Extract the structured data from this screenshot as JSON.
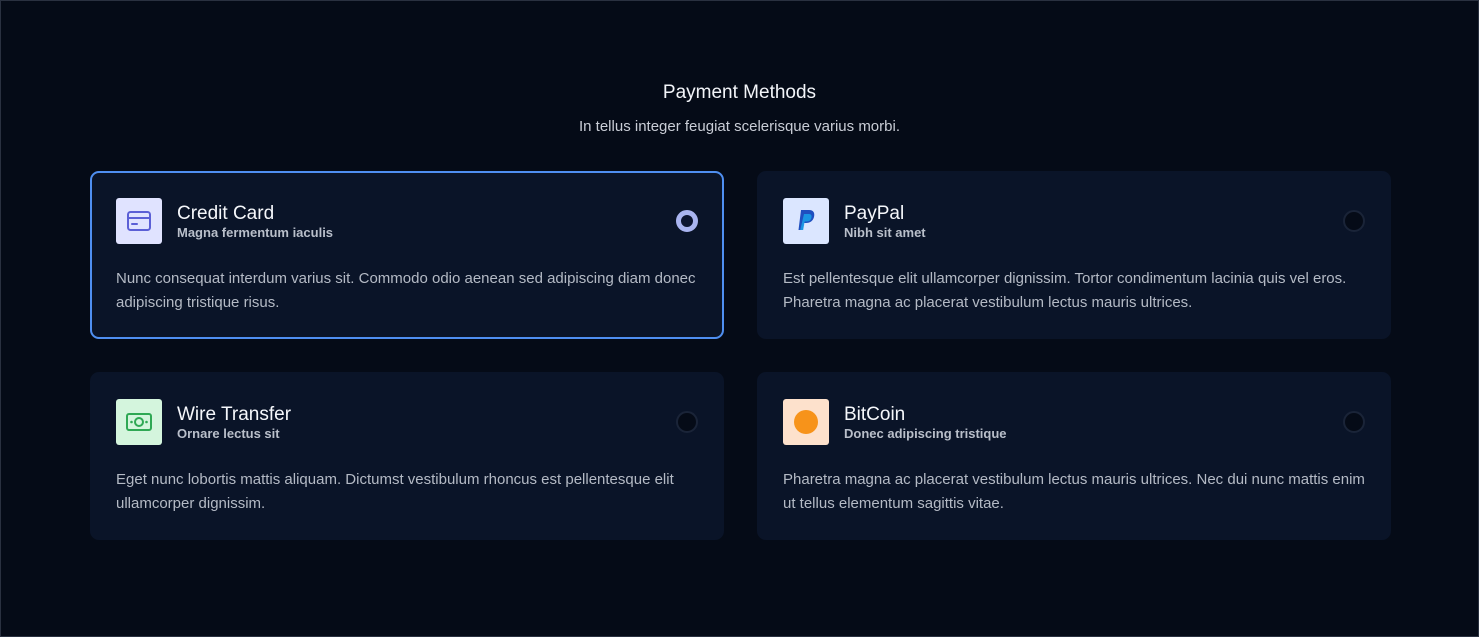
{
  "header": {
    "title": "Payment Methods",
    "subtitle": "In tellus integer feugiat scelerisque varius morbi."
  },
  "methods": [
    {
      "title": "Credit Card",
      "subtitle": "Magna fermentum iaculis",
      "description": "Nunc consequat interdum varius sit. Commodo odio aenean sed adipiscing diam donec adipiscing tristique risus.",
      "icon": "credit-card-icon",
      "icon_bg": "#e0e3ff",
      "icon_color": "#5b5fd6",
      "selected": true
    },
    {
      "title": "PayPal",
      "subtitle": "Nibh sit amet",
      "description": "Est pellentesque elit ullamcorper dignissim. Tortor condimentum lacinia quis vel eros. Pharetra magna ac placerat vestibulum lectus mauris ultrices.",
      "icon": "paypal-icon",
      "icon_bg": "#dbe6ff",
      "icon_color": "#1f4fbf",
      "selected": false
    },
    {
      "title": "Wire Transfer",
      "subtitle": "Ornare lectus sit",
      "description": "Eget nunc lobortis mattis aliquam. Dictumst vestibulum rhoncus est pellentesque elit ullamcorper dignissim.",
      "icon": "banknote-icon",
      "icon_bg": "#d4f5dd",
      "icon_color": "#2fa854",
      "selected": false
    },
    {
      "title": "BitCoin",
      "subtitle": "Donec adipiscing tristique",
      "description": "Pharetra magna ac placerat vestibulum lectus mauris ultrices. Nec dui nunc mattis enim ut tellus elementum sagittis vitae.",
      "icon": "bitcoin-icon",
      "icon_bg": "#fde1cc",
      "icon_color": "#f7931a",
      "selected": false
    }
  ]
}
